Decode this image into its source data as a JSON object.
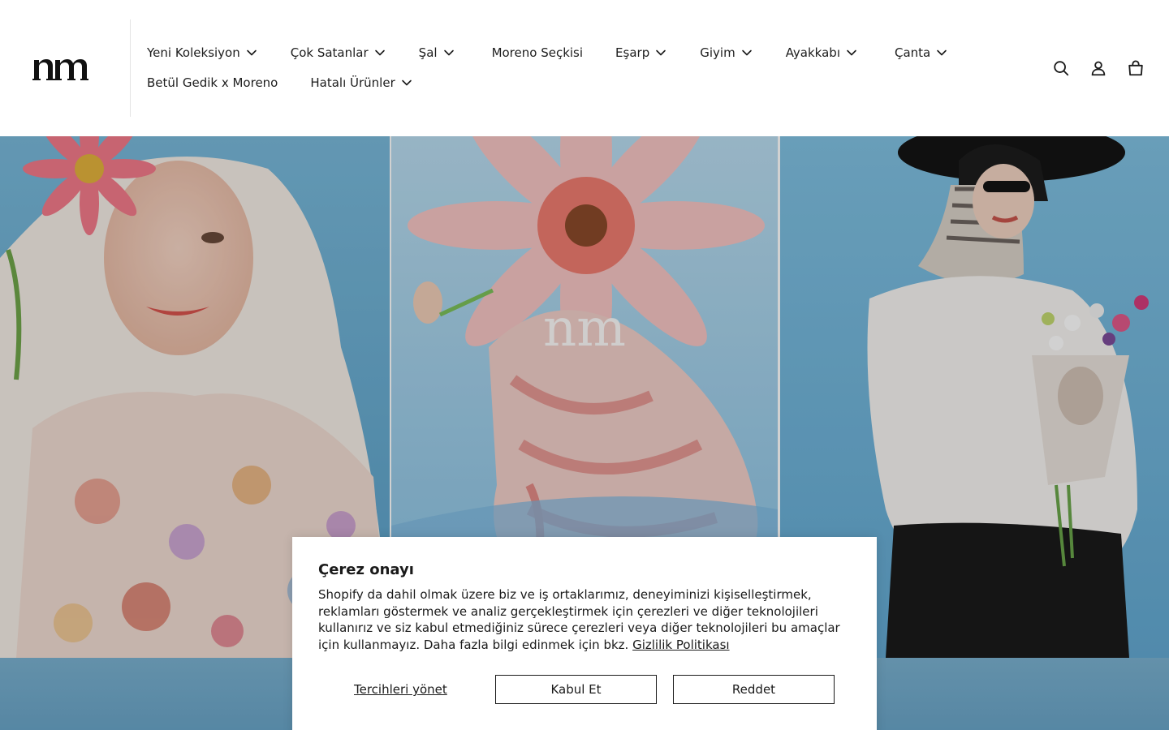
{
  "brand": {
    "logo_text": "nm"
  },
  "nav": {
    "row1": [
      {
        "label": "Yeni Koleksiyon",
        "has_dropdown": true
      },
      {
        "label": "Çok Satanlar",
        "has_dropdown": true
      },
      {
        "label": "Şal",
        "has_dropdown": true
      },
      {
        "label": "Moreno Seçkisi",
        "has_dropdown": false
      },
      {
        "label": "Eşarp",
        "has_dropdown": true
      },
      {
        "label": "Giyim",
        "has_dropdown": true
      },
      {
        "label": "Ayakkabı",
        "has_dropdown": true
      },
      {
        "label": "Çanta",
        "has_dropdown": true
      }
    ],
    "row2": [
      {
        "label": "Betül Gedik x Moreno",
        "has_dropdown": false
      },
      {
        "label": "Hatalı Ürünler",
        "has_dropdown": true
      }
    ]
  },
  "header_icons": [
    "search-icon",
    "account-icon",
    "cart-icon"
  ],
  "hero": {
    "watermark_text": "nm"
  },
  "cookie": {
    "title": "Çerez onayı",
    "text": "Shopify da dahil olmak üzere biz ve iş ortaklarımız, deneyiminizi kişiselleştirmek, reklamları göstermek ve analiz gerçekleştirmek için çerezleri ve diğer teknolojileri kullanırız ve siz kabul etmediğiniz sürece çerezleri veya diğer teknolojileri bu amaçlar için kullanmayız. Daha fazla bilgi edinmek için bkz.",
    "policy_link": "Gizlilik Politikası",
    "manage_label": "Tercihleri yönet",
    "accept_label": "Kabul Et",
    "decline_label": "Reddet"
  },
  "colors": {
    "sky_blue": "#8ec3e0",
    "flower_pink": "#f2a8a8",
    "text": "#1a1a1a"
  }
}
